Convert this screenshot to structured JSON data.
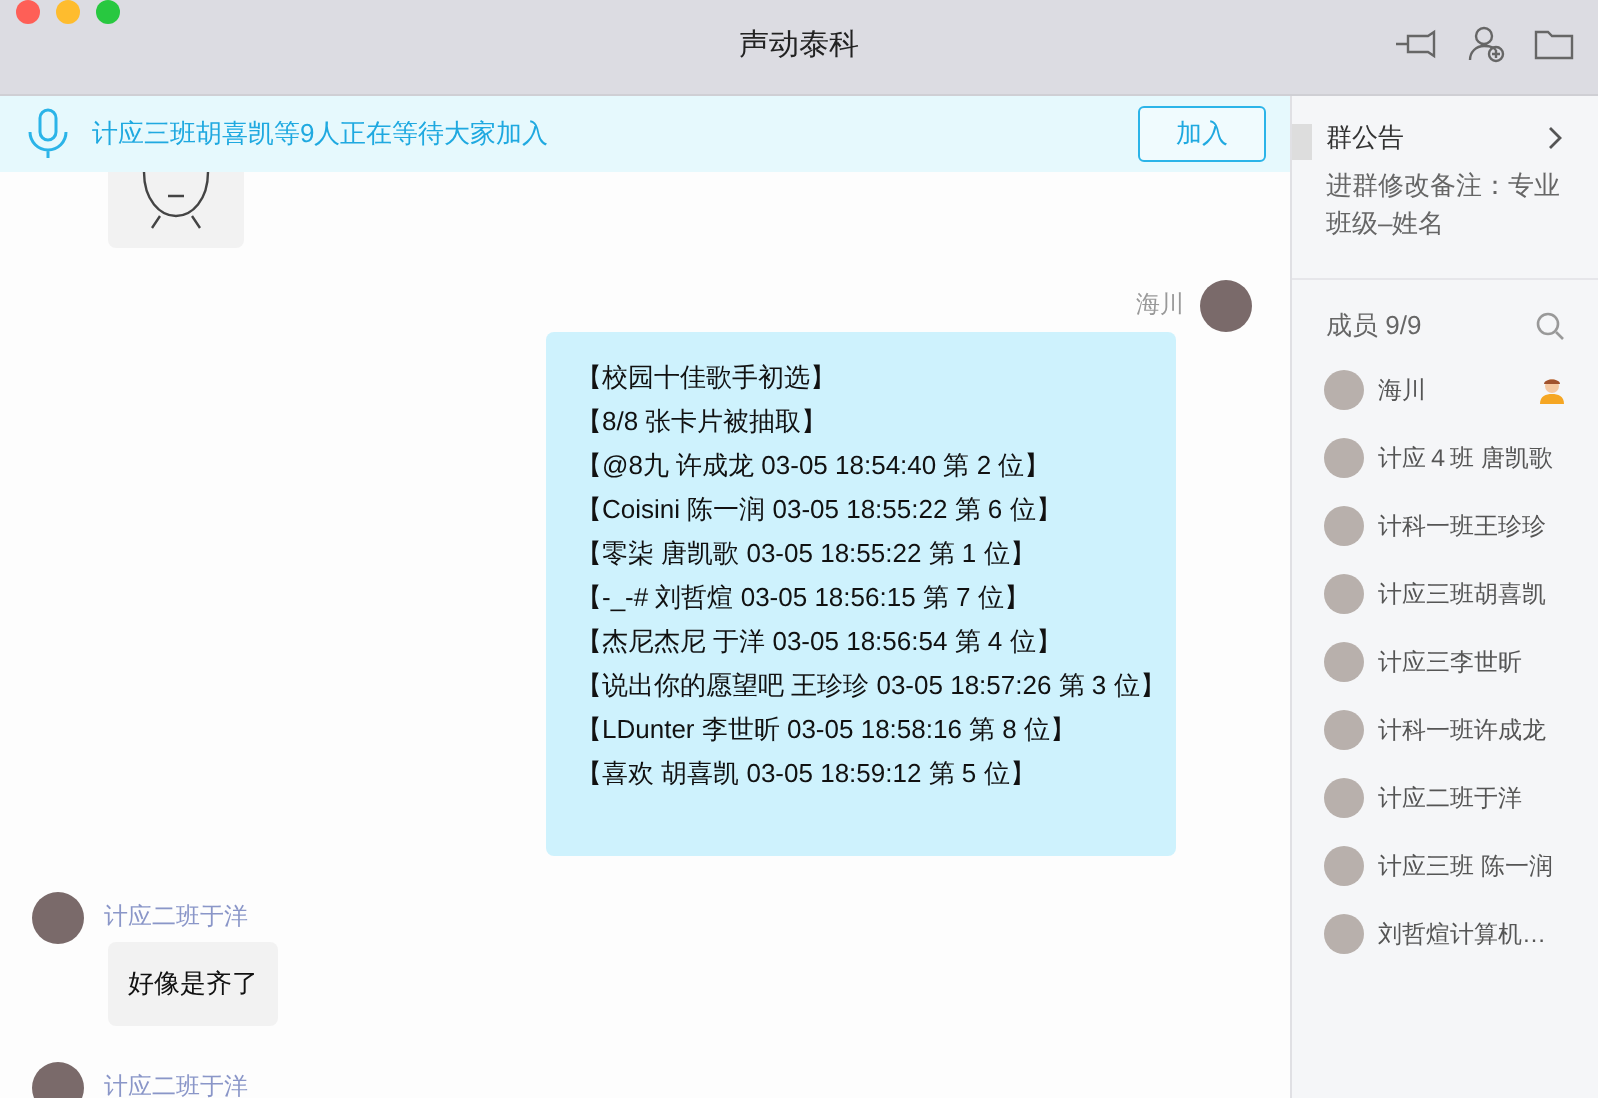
{
  "window": {
    "title": "声动泰科"
  },
  "banner": {
    "text": "计应三班胡喜凯等9人正在等待大家加入",
    "button": "加入"
  },
  "messages": [
    {
      "kind": "sticker"
    },
    {
      "kind": "text",
      "mine": true,
      "sender": "海川",
      "lines": [
        "【校园十佳歌手初选】",
        "【8/8 张卡片被抽取】",
        "【@8九 许成龙 03-05 18:54:40 第 2 位】",
        "【Coisini 陈一润 03-05 18:55:22 第 6 位】",
        "【零柒 唐凯歌 03-05 18:55:22 第 1 位】",
        "【-_-# 刘哲煊 03-05 18:56:15 第 7 位】",
        "【杰尼杰尼 于洋 03-05 18:56:54 第 4 位】",
        "【说出你的愿望吧 王珍珍 03-05 18:57:26 第 3 位】",
        "【LDunter 李世昕 03-05 18:58:16 第 8 位】",
        "【喜欢 胡喜凯 03-05 18:59:12 第 5 位】"
      ]
    },
    {
      "kind": "text",
      "mine": false,
      "sender": "计应二班于洋",
      "lines": [
        "好像是齐了"
      ]
    },
    {
      "kind": "text",
      "mine": false,
      "sender": "计应二班于洋"
    }
  ],
  "notice": {
    "title": "群公告",
    "text": "进群修改备注：专业班级–姓名"
  },
  "members": {
    "title": "成员 9/9",
    "items": [
      {
        "name": "海川",
        "owner": true
      },
      {
        "name": "计应４班 唐凯歌",
        "owner": false
      },
      {
        "name": "计科一班王珍珍",
        "owner": false
      },
      {
        "name": "计应三班胡喜凯",
        "owner": false
      },
      {
        "name": "计应三李世昕",
        "owner": false
      },
      {
        "name": "计科一班许成龙",
        "owner": false
      },
      {
        "name": "计应二班于洋",
        "owner": false
      },
      {
        "name": "计应三班 陈一润",
        "owner": false
      },
      {
        "name": "刘哲煊计算机…",
        "owner": false
      }
    ]
  }
}
